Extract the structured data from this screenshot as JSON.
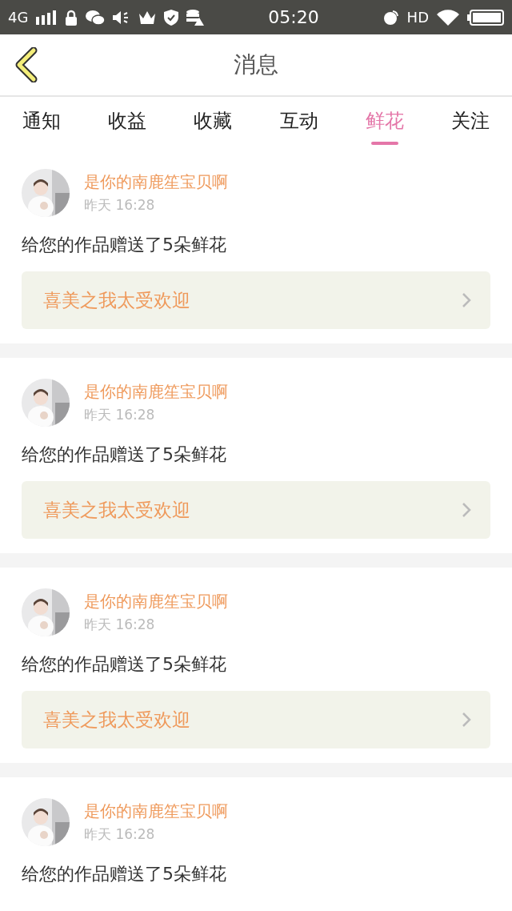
{
  "status_bar": {
    "network": "4G",
    "time": "05:20",
    "hd": "HD"
  },
  "header": {
    "title": "消息"
  },
  "tabs": [
    {
      "label": "通知",
      "selected": false
    },
    {
      "label": "收益",
      "selected": false
    },
    {
      "label": "收藏",
      "selected": false
    },
    {
      "label": "互动",
      "selected": false
    },
    {
      "label": "鲜花",
      "selected": true
    },
    {
      "label": "关注",
      "selected": false
    }
  ],
  "messages": [
    {
      "name": "是你的南鹿笙宝贝啊",
      "time": "昨天 16:28",
      "text": "给您的作品赠送了5朵鲜花",
      "work": "喜美之我太受欢迎"
    },
    {
      "name": "是你的南鹿笙宝贝啊",
      "time": "昨天 16:28",
      "text": "给您的作品赠送了5朵鲜花",
      "work": "喜美之我太受欢迎"
    },
    {
      "name": "是你的南鹿笙宝贝啊",
      "time": "昨天 16:28",
      "text": "给您的作品赠送了5朵鲜花",
      "work": "喜美之我太受欢迎"
    },
    {
      "name": "是你的南鹿笙宝贝啊",
      "time": "昨天 16:28",
      "text": "给您的作品赠送了5朵鲜花"
    }
  ]
}
